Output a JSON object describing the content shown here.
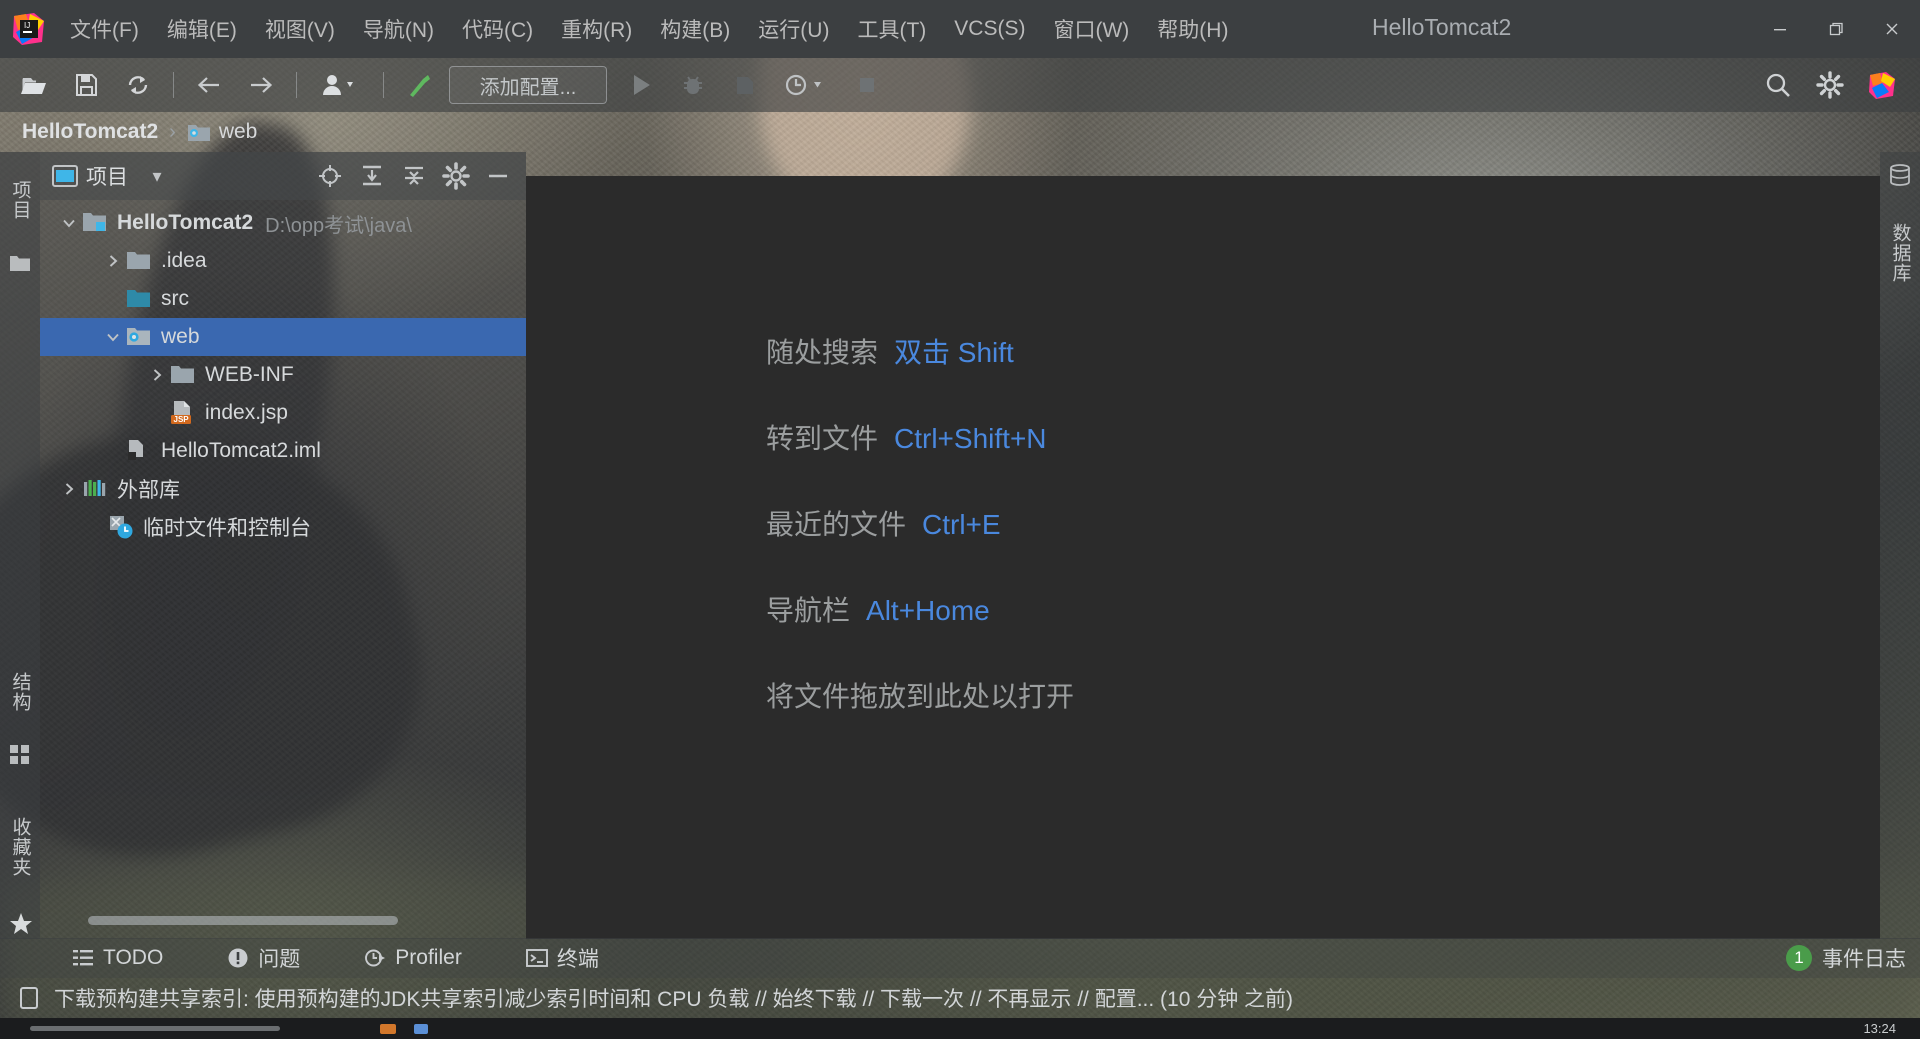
{
  "window": {
    "title": "HelloTomcat2",
    "minimize_label": "—",
    "restore_label": "❐",
    "close_label": "✕"
  },
  "menu": {
    "items": [
      {
        "label": "文件(F)",
        "name": "menu-file"
      },
      {
        "label": "编辑(E)",
        "name": "menu-edit"
      },
      {
        "label": "视图(V)",
        "name": "menu-view"
      },
      {
        "label": "导航(N)",
        "name": "menu-navigate"
      },
      {
        "label": "代码(C)",
        "name": "menu-code"
      },
      {
        "label": "重构(R)",
        "name": "menu-refactor"
      },
      {
        "label": "构建(B)",
        "name": "menu-build"
      },
      {
        "label": "运行(U)",
        "name": "menu-run"
      },
      {
        "label": "工具(T)",
        "name": "menu-tools"
      },
      {
        "label": "VCS(S)",
        "name": "menu-vcs"
      },
      {
        "label": "窗口(W)",
        "name": "menu-window"
      },
      {
        "label": "帮助(H)",
        "name": "menu-help"
      }
    ]
  },
  "toolbar": {
    "open_label": "open-folder-icon",
    "save_label": "save-all-icon",
    "sync_label": "sync-icon",
    "back_label": "back-arrow-icon",
    "forward_label": "forward-arrow-icon",
    "profile_label": "user-profile-icon",
    "build_label": "build-hammer-icon",
    "run_config": "添加配置...",
    "run_label": "run-icon",
    "debug_label": "debug-icon",
    "coverage_label": "run-with-coverage-icon",
    "profiler_label": "profiler-icon",
    "stop_label": "stop-icon",
    "search_label": "search-icon",
    "settings_label": "gear-icon",
    "idea_label": "idea-logo-icon"
  },
  "breadcrumb": {
    "project": "HelloTomcat2",
    "separator": "›",
    "items": [
      {
        "label": "web",
        "icon": "web-folder-icon"
      }
    ]
  },
  "left_strip": {
    "tabs": [
      {
        "label": "项目",
        "name": "tool-tab-project"
      },
      {
        "label": "结构",
        "name": "tool-tab-structure"
      },
      {
        "label": "收藏夹",
        "name": "tool-tab-favorites"
      }
    ]
  },
  "right_strip": {
    "tabs": [
      {
        "label": "数据库",
        "name": "tool-tab-database"
      }
    ]
  },
  "project_panel": {
    "title": "项目",
    "dropdown": "▾",
    "actions": [
      {
        "name": "select-opened-file-icon",
        "title": "select-target"
      },
      {
        "name": "expand-all-icon",
        "title": "expand"
      },
      {
        "name": "collapse-all-icon",
        "title": "collapse"
      },
      {
        "name": "gear-icon",
        "title": "settings"
      },
      {
        "name": "hide-icon",
        "title": "hide"
      }
    ],
    "tree": [
      {
        "label": "HelloTomcat2",
        "path": "D:\\opp考试\\java\\",
        "indent": 0,
        "arrow": "expanded",
        "icon": "project-module-icon",
        "bold": true,
        "selected": false,
        "name": "tree-node-hellotomcat2"
      },
      {
        "label": ".idea",
        "path": "",
        "indent": 1,
        "arrow": "collapsed",
        "icon": "folder-icon",
        "bold": false,
        "selected": false,
        "name": "tree-node-idea"
      },
      {
        "label": "src",
        "path": "",
        "indent": 1,
        "arrow": "none",
        "icon": "source-folder-icon",
        "bold": false,
        "selected": false,
        "name": "tree-node-src"
      },
      {
        "label": "web",
        "path": "",
        "indent": 1,
        "arrow": "expanded",
        "icon": "web-folder-icon",
        "bold": false,
        "selected": true,
        "name": "tree-node-web"
      },
      {
        "label": "WEB-INF",
        "path": "",
        "indent": 2,
        "arrow": "collapsed",
        "icon": "folder-icon",
        "bold": false,
        "selected": false,
        "name": "tree-node-web-inf"
      },
      {
        "label": "index.jsp",
        "path": "",
        "indent": 2,
        "arrow": "none",
        "icon": "jsp-file-icon",
        "bold": false,
        "selected": false,
        "name": "tree-node-index-jsp"
      },
      {
        "label": "HelloTomcat2.iml",
        "path": "",
        "indent": 1,
        "arrow": "none",
        "icon": "iml-file-icon",
        "bold": false,
        "selected": false,
        "name": "tree-node-iml"
      },
      {
        "label": "外部库",
        "path": "",
        "indent": 0,
        "arrow": "collapsed",
        "icon": "external-libraries-icon",
        "bold": false,
        "selected": false,
        "name": "tree-node-external-libraries"
      },
      {
        "label": "临时文件和控制台",
        "path": "",
        "indent": 0,
        "arrow": "none",
        "icon": "scratches-icon",
        "bold": false,
        "selected": false,
        "name": "tree-node-scratches"
      }
    ]
  },
  "editor": {
    "hints": [
      {
        "action": "随处搜索",
        "key": "双击 Shift",
        "name": "hint-search-everywhere"
      },
      {
        "action": "转到文件",
        "key": "Ctrl+Shift+N",
        "name": "hint-go-to-file"
      },
      {
        "action": "最近的文件",
        "key": "Ctrl+E",
        "name": "hint-recent-files"
      },
      {
        "action": "导航栏",
        "key": "Alt+Home",
        "name": "hint-navigation-bar"
      },
      {
        "action": "将文件拖放到此处以打开",
        "key": "",
        "name": "hint-drop-files"
      }
    ]
  },
  "bottom_bar": {
    "items": [
      {
        "label": "TODO",
        "icon": "todo-list-icon",
        "name": "tool-button-todo"
      },
      {
        "label": "问题",
        "icon": "problems-icon",
        "name": "tool-button-problems"
      },
      {
        "label": "Profiler",
        "icon": "profiler-icon",
        "name": "tool-button-profiler"
      },
      {
        "label": "终端",
        "icon": "terminal-icon",
        "name": "tool-button-terminal"
      }
    ],
    "event_log": {
      "label": "事件日志",
      "count": "1"
    }
  },
  "status_bar": {
    "icon": "notification-icon",
    "text": "下载预构建共享索引: 使用预构建的JDK共享索引减少索引时间和 CPU 负载 // 始终下载 // 下载一次 // 不再显示 // 配置... (10 分钟 之前)"
  },
  "taskbar": {
    "time": "13:24"
  },
  "colors": {
    "accent_blue": "#4a88de",
    "selection_blue": "#3a68b0",
    "panel_bg": "#3c3f41",
    "editor_bg": "#2b2b2b",
    "badge_green": "#4a9c4a",
    "jsp_orange": "#cc6419"
  }
}
